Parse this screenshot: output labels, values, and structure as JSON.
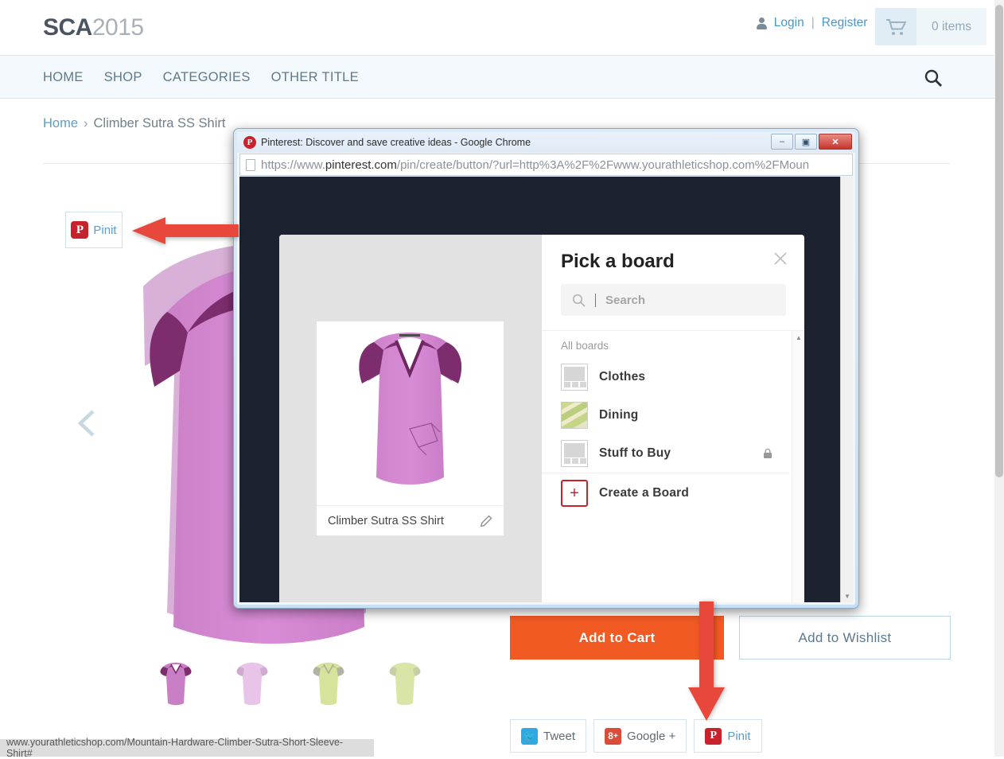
{
  "site": {
    "logo": {
      "bold": "SCA",
      "light": "2015"
    },
    "account": {
      "login": "Login",
      "separator": "|",
      "register": "Register",
      "lang_icon": "globe-icon",
      "caret": "⌄"
    },
    "cart": {
      "icon": "cart-icon",
      "count_label": "0 items"
    },
    "nav": [
      {
        "label": "HOME"
      },
      {
        "label": "SHOP"
      },
      {
        "label": "CATEGORIES"
      },
      {
        "label": "OTHER TITLE"
      }
    ],
    "search_icon": "search-icon",
    "breadcrumb": {
      "home": "Home",
      "chevron": "›",
      "current": "Climber Sutra SS Shirt"
    },
    "pinit_top": {
      "label": "Pinit",
      "badge": "P"
    },
    "gallery": {
      "prev_icon": "chevron-left-icon",
      "thumb_count": 4
    },
    "buttons": {
      "add_to_cart": "Add to Cart",
      "add_to_wishlist": "Add to Wishlist"
    },
    "social": [
      {
        "name": "twitter",
        "label": "Tweet",
        "glyph": "🐦",
        "color": "#2eaae0"
      },
      {
        "name": "google-plus",
        "label": "Google +",
        "glyph": "8⁺",
        "color": "#dd4b39"
      },
      {
        "name": "pinterest",
        "label": "Pinit",
        "glyph": "P",
        "color": "#c8232c"
      }
    ],
    "status_bar": "www.yourathleticshop.com/Mountain-Hardware-Climber-Sutra-Short-Sleeve-Shirt#"
  },
  "chrome_window": {
    "title": "Pinterest: Discover and save creative ideas - Google Chrome",
    "title_icon": "pinterest-icon",
    "window_buttons": {
      "minimize": "–",
      "maximize": "▣",
      "close": "✕"
    },
    "url": {
      "icon": "page-icon",
      "prefix": "https://www.",
      "host": "pinterest.com",
      "path": "/pin/create/button/?url=http%3A%2F%2Fwww.yourathleticshop.com%2FMoun"
    }
  },
  "pinterest_modal": {
    "preview": {
      "caption": "Climber Sutra SS Shirt",
      "edit_icon": "pencil-icon"
    },
    "title": "Pick a board",
    "close_icon": "close-icon",
    "search": {
      "placeholder": "Search",
      "value": "",
      "icon": "search-icon"
    },
    "section_label": "All boards",
    "boards": [
      {
        "name": "Clothes",
        "thumb": "placeholder",
        "private": false
      },
      {
        "name": "Dining",
        "thumb": "photo",
        "private": false
      },
      {
        "name": "Stuff to Buy",
        "thumb": "placeholder",
        "private": true
      }
    ],
    "create_board": {
      "label": "Create a Board",
      "icon": "plus-icon"
    }
  },
  "annotations": {
    "arrow_left": {
      "name": "arrow-pointing-to-pinit-button",
      "color": "#e8473c"
    },
    "arrow_down": {
      "name": "arrow-pointing-to-pinit-share-button",
      "color": "#e8473c"
    }
  }
}
